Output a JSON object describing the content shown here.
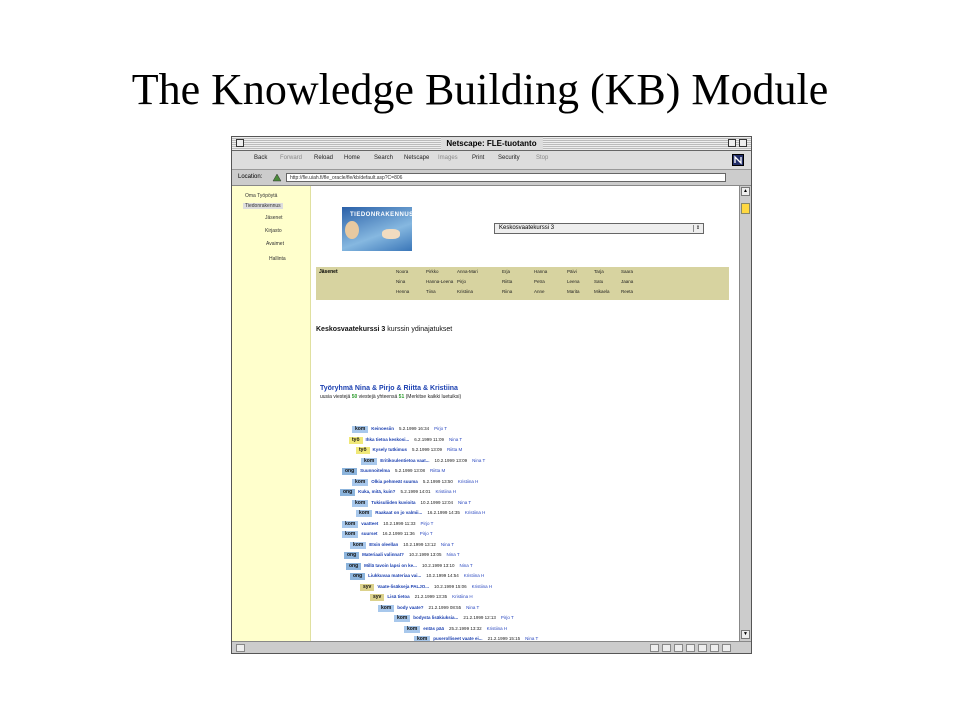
{
  "slide": {
    "title": "The Knowledge Building (KB) Module"
  },
  "browser": {
    "title": "Netscape: FLE-tuotanto",
    "toolbar": [
      {
        "label": "Back",
        "dim": false
      },
      {
        "label": "Forward",
        "dim": true
      },
      {
        "label": "Reload",
        "dim": false
      },
      {
        "label": "Home",
        "dim": false
      },
      {
        "label": "Search",
        "dim": false
      },
      {
        "label": "Netscape",
        "dim": false
      },
      {
        "label": "Images",
        "dim": true
      },
      {
        "label": "Print",
        "dim": false
      },
      {
        "label": "Security",
        "dim": false
      },
      {
        "label": "Stop",
        "dim": true
      }
    ],
    "location_label": "Location:",
    "url": "http://fle.uiah.fi/fle_oracle/fle/kb/default.asp?C=806"
  },
  "sidebar": [
    {
      "label": "Oma Työpöytä",
      "selected": false
    },
    {
      "label": "Tiedonrakennus",
      "selected": true
    },
    {
      "label": "Jäsenet",
      "selected": false
    },
    {
      "label": "Kirjasto",
      "selected": false
    },
    {
      "label": "Avaimet",
      "selected": false
    },
    {
      "label": "Hallinta",
      "selected": false
    }
  ],
  "logo_text": "TIEDONRAKENNUS",
  "course_select": "Keskosvaatekurssi 3",
  "members": {
    "header": "Jäsenet",
    "rows": [
      [
        "Noora",
        "Pirkko",
        "Anna-Mari",
        "Erja",
        "Hanna",
        "Päivi",
        "Tarja",
        "Saara"
      ],
      [
        "Nina",
        "Hanna-Leena",
        "Pirjo",
        "Riitta",
        "Petra",
        "Leena",
        "Satu",
        "Jaana"
      ],
      [
        "Henna",
        "Tiina",
        "Kristiina",
        "Riina",
        "Anne",
        "Marita",
        "Mikaela",
        "Reeta"
      ]
    ]
  },
  "heading": {
    "bold": "Keskosvaatekurssi 3",
    "rest": " kurssin ydinajatukset"
  },
  "group": {
    "title": "Työryhmä Nina & Pirjo & Riitta & Kristiina",
    "sub_pre": "uusia viestejä",
    "new_count": "50",
    "sub_mid": "viestejä yhteensä",
    "total_count": "51",
    "sub_post": "(Merkitse kaikki luetuiksi)"
  },
  "notes": [
    {
      "tag": "kom",
      "type": "kom",
      "title": "Keinoesiin",
      "date": "5.2.1999 16:34",
      "author": "Pirjo T"
    },
    {
      "tag": "työ",
      "type": "tyo",
      "title": "Ihka tietoa keskosi...",
      "date": "6.2.1999 11:09",
      "author": "Nina T"
    },
    {
      "tag": "työ",
      "type": "tyo",
      "title": "Kysely tutkimus",
      "date": "5.2.1999 13:09",
      "author": "Riitta M"
    },
    {
      "tag": "kom",
      "type": "kom",
      "title": "Eritikoulentietoa vaat...",
      "date": "10.2.1999 13:09",
      "author": "Nina T"
    },
    {
      "tag": "ong",
      "type": "ong",
      "title": "Suunnoitelma",
      "date": "5.2.1999 13:08",
      "author": "Riitta M"
    },
    {
      "tag": "kom",
      "type": "kom",
      "title": "Olkia pehmeät suuma",
      "date": "5.2.1999 13:50",
      "author": "Kristiina H"
    },
    {
      "tag": "ong",
      "type": "ong",
      "title": "Kuka, mitä, kuin?",
      "date": "5.2.1999 14:01",
      "author": "Kristiina H"
    },
    {
      "tag": "kom",
      "type": "kom",
      "title": "Tukisuliiden kuvioita",
      "date": "10.2.1999 12:04",
      "author": "Nina T"
    },
    {
      "tag": "kom",
      "type": "kom",
      "title": "Raakaat on jo valmii...",
      "date": "16.2.1999 14:35",
      "author": "Kristiina H"
    },
    {
      "tag": "kom",
      "type": "kom",
      "title": "vaatteet",
      "date": "10.2.1999 11:33",
      "author": "Pirjo T"
    },
    {
      "tag": "kom",
      "type": "kom",
      "title": "suurset",
      "date": "16.2.1999 11:36",
      "author": "Pirjo T"
    },
    {
      "tag": "kom",
      "type": "kom",
      "title": "Etsin oleellan",
      "date": "10.2.1999 13:12",
      "author": "Nina T"
    },
    {
      "tag": "ong",
      "type": "ong",
      "title": "Materiaali valinnat?",
      "date": "10.2.1999 13:05",
      "author": "Nina T"
    },
    {
      "tag": "ong",
      "type": "ong",
      "title": "Millä tavoin lapsi on ke...",
      "date": "10.2.1999 13:10",
      "author": "Nina T"
    },
    {
      "tag": "ong",
      "type": "ong",
      "title": "Liukkuvaa materiaa vai...",
      "date": "10.2.1999 14:54",
      "author": "Kristiina H"
    },
    {
      "tag": "syv",
      "type": "syv",
      "title": "Vaate-lisäkseja PALJO...",
      "date": "10.2.1999 15:06",
      "author": "Kristiina H"
    },
    {
      "tag": "syv",
      "type": "syv",
      "title": "Lisä tietoa",
      "date": "21.2.1999 13:35",
      "author": "Kristiina H"
    },
    {
      "tag": "kom",
      "type": "kom",
      "title": "body vaate?",
      "date": "21.2.1999 08:55",
      "author": "Nina T"
    },
    {
      "tag": "kom",
      "type": "kom",
      "title": "bodysta lisäkiuksia...",
      "date": "21.2.1999 12:13",
      "author": "Pirjo T"
    },
    {
      "tag": "kom",
      "type": "kom",
      "title": "entäs pää",
      "date": "25.2.1999 13:32",
      "author": "Kristiina H"
    },
    {
      "tag": "kom",
      "type": "kom",
      "title": "puserolliseet vaate ei...",
      "date": "21.2.1999 15:15",
      "author": "Nina T"
    }
  ]
}
